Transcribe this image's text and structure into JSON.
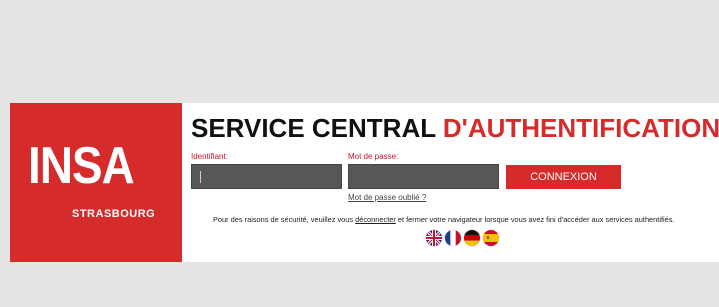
{
  "logo": {
    "main_text": "INSA",
    "sub_text": "STRASBOURG"
  },
  "title": {
    "part1": "SERVICE CENTRAL ",
    "part2": "D'AUTHENTIFICATION"
  },
  "form": {
    "username_label": "Identifiant:",
    "username_value": "",
    "password_label": "Mot de passe:",
    "password_value": "",
    "submit_label": "CONNEXION",
    "forgot_label": "Mot de passe oublié ?"
  },
  "notice": {
    "before": "Pour des raisons de sécurité, veuillez vous ",
    "link": "déconnecter",
    "after": " et fermer votre navigateur lorsque vous avez fini d'accéder aux services authentifiés."
  },
  "languages": [
    "uk-flag-icon",
    "france-flag-icon",
    "germany-flag-icon",
    "spain-flag-icon"
  ],
  "colors": {
    "brand_red": "#d52b2b",
    "input_bg": "#575757",
    "page_bg": "#e4e4e4"
  }
}
